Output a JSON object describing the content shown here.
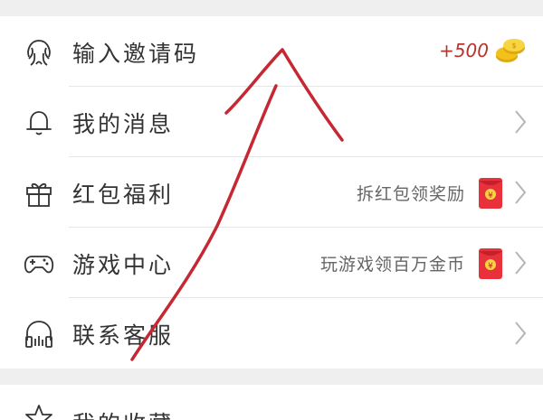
{
  "menu": {
    "items": [
      {
        "label": "输入邀请码",
        "icon": "face-icon",
        "bonus": "+500"
      },
      {
        "label": "我的消息",
        "icon": "bell-icon"
      },
      {
        "label": "红包福利",
        "icon": "gift-icon",
        "hint": "拆红包领奖励"
      },
      {
        "label": "游戏中心",
        "icon": "gamepad-icon",
        "hint": "玩游戏领百万金币"
      },
      {
        "label": "联系客服",
        "icon": "headset-icon"
      }
    ]
  },
  "menu2": {
    "items": [
      {
        "label": "我的收藏",
        "icon": "star-icon"
      }
    ]
  },
  "colors": {
    "bonus_text": "#b8332d",
    "envelope": "#e8313a",
    "coin": "#f2c21a",
    "annotation_arrow": "#c62833"
  }
}
